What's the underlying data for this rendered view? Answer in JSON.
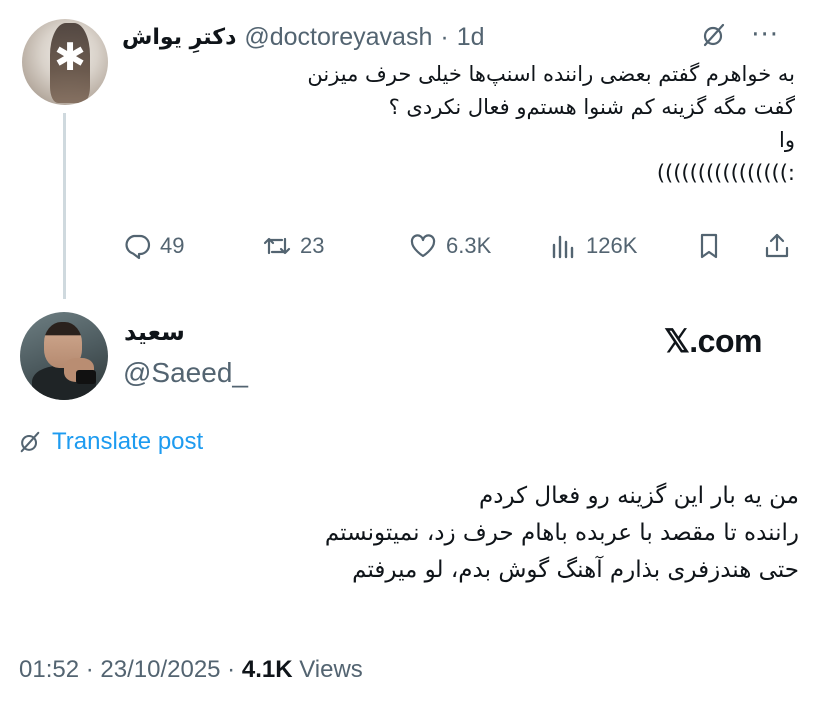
{
  "tweet1": {
    "author_name": "دکترِ یواش",
    "handle": "@doctoreyavash",
    "separator": "·",
    "time": "1d",
    "body_lines": [
      "به خواهرم گفتم بعضی راننده اسنپ‌ها خیلی حرف میزنن",
      "گفت مگه گزینه کم شنوا هستم‌و فعال نکردی ؟",
      "وا",
      ":))))))))))))))))"
    ],
    "actions": {
      "replies": "49",
      "reposts": "23",
      "likes": "6.3K",
      "views": "126K"
    },
    "icons": {
      "grok": "slashed-circle-icon",
      "more": "more-dots-icon",
      "reply": "reply-icon",
      "repost": "repost-icon",
      "like": "heart-icon",
      "views": "views-bars-icon",
      "bookmark": "bookmark-icon",
      "share": "share-icon"
    }
  },
  "tweet2": {
    "author_name": "سعید",
    "handle": "@Saeed_",
    "watermark": "𝕏.com",
    "translate_label": "Translate post",
    "body_lines": [
      "من یه بار این گزینه رو فعال کردم",
      "راننده تا مقصد با عربده باهام حرف زد، نمیتونستم",
      "حتی هندزفری بذارم آهنگ گوش بدم، لو میرفتم"
    ],
    "time": "01:52",
    "date": "23/10/2025",
    "views_count": "4.1K",
    "views_label": "Views",
    "separator": " · "
  },
  "colors": {
    "text": "#0f1419",
    "muted": "#536471",
    "link": "#1d9bf0",
    "thread_line": "#cfd9de"
  }
}
